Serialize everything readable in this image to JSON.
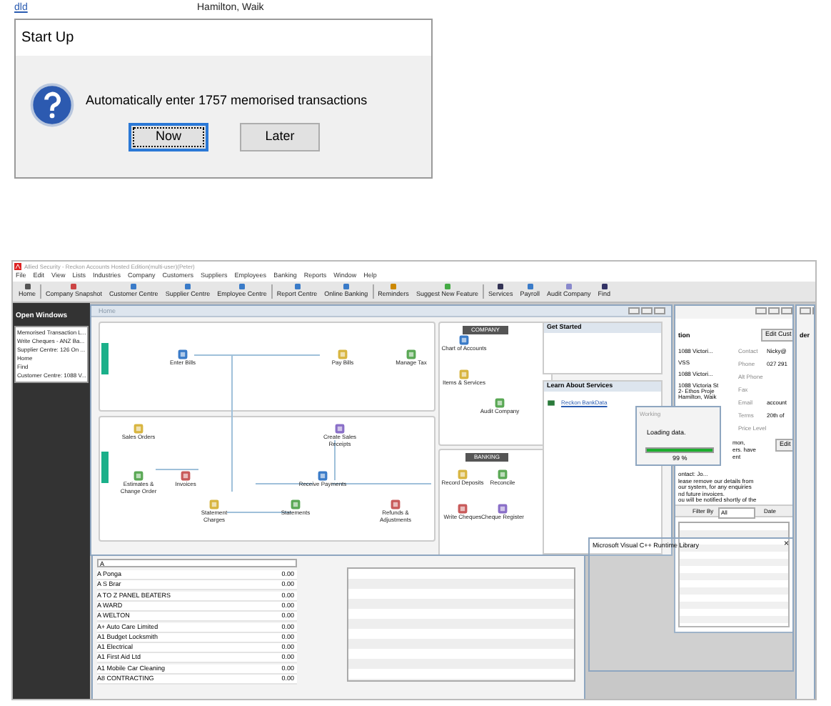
{
  "background_text": {
    "link": "dld",
    "address": "Hamilton, Waik"
  },
  "startup_dialog": {
    "title": "Start Up",
    "message": "Automatically enter 1757 memorised transactions",
    "buttons": [
      {
        "label": "Now",
        "selected": true
      },
      {
        "label": "Later",
        "selected": false
      }
    ]
  },
  "app": {
    "window_title": "Allied Security - Reckon Accounts Hosted Edition(multi-user)(Peter)",
    "menu": [
      "File",
      "Edit",
      "View",
      "Lists",
      "Industries",
      "Company",
      "Customers",
      "Suppliers",
      "Employees",
      "Banking",
      "Reports",
      "Window",
      "Help"
    ],
    "toolbar": [
      "Home",
      "Company Snapshot",
      "Customer Centre",
      "Supplier Centre",
      "Employee Centre",
      "Report Centre",
      "Online Banking",
      "Reminders",
      "Suggest New Feature",
      "Services",
      "Payroll",
      "Audit Company",
      "Find"
    ],
    "open_windows": {
      "title": "Open Windows",
      "items": [
        "Memorised Transaction L...",
        "Write Cheques - ANZ Ba...",
        "Supplier Centre: 126 On ...",
        "Home",
        "Find",
        "Customer Centre: 1088 V..."
      ]
    },
    "home": {
      "title": "Home",
      "suppliers": [
        "Enter Bills",
        "Pay Bills",
        "Manage Tax"
      ],
      "customers": [
        "Sales Orders",
        "Estimates & Change Order",
        "Invoices",
        "Create Sales Receipts",
        "Receive Payments",
        "Statement Charges",
        "Statements",
        "Refunds & Adjustments"
      ],
      "company": {
        "title": "COMPANY",
        "items": [
          "Chart of Accounts",
          "Items & Services",
          "Audit Company"
        ]
      },
      "banking": {
        "title": "BANKING",
        "items": [
          "Record Deposits",
          "Reconcile",
          "Write Cheques",
          "Cheque Register"
        ]
      },
      "get_started": {
        "title": "Get Started"
      },
      "services": {
        "title": "Learn About Services",
        "link": "Reckon BankData"
      }
    },
    "working": {
      "title": "Working",
      "message": "Loading data.",
      "level": 0.99,
      "reading": "99 %"
    },
    "customer": {
      "heading": "tion",
      "edit_button": "Edit Cust",
      "heading_2": "der",
      "address": [
        "1088 Victori...",
        "VSS",
        "1088 Victori...",
        "1088 Victoria St",
        "2- Ethos Proje",
        "Hamilton, Waik"
      ],
      "fields": [
        {
          "label": "Contact",
          "value": "Nicky@"
        },
        {
          "label": "Phone",
          "value": "027 291"
        },
        {
          "label": "Alt Phone"
        },
        {
          "label": "Fax"
        },
        {
          "label": "Email",
          "value": "account"
        },
        {
          "label": "Terms",
          "value": "20th of"
        },
        {
          "label": "Price Level"
        }
      ],
      "notes_edit": "Edit",
      "notes": [
        "mon,",
        "ers. have",
        "ent",
        "ontact: Jo...",
        "lease remove our details from",
        "our system, for any enquiries",
        "nd future invoices.",
        "ou will be notified shortly of the"
      ],
      "filter": {
        "label": "Filter By",
        "value": "All",
        "date_label": "Date"
      }
    },
    "runtime_window": {
      "title": "Microsoft Visual C++ Runtime Library",
      "close": "×"
    },
    "list": {
      "search": "A",
      "rows": [
        {
          "name": "A Ponga",
          "balance": "0.00"
        },
        {
          "name": "A S Brar",
          "balance": "0.00"
        },
        {
          "name": "A TO Z PANEL BEATERS",
          "balance": "0.00"
        },
        {
          "name": "A WARD",
          "balance": "0.00"
        },
        {
          "name": "A WELTON",
          "balance": "0.00"
        },
        {
          "name": "A+ Auto Care Limited",
          "balance": "0.00"
        },
        {
          "name": "A1 Budget Locksmith",
          "balance": "0.00"
        },
        {
          "name": "A1 Electrical",
          "balance": "0.00"
        },
        {
          "name": "A1 First Aid Ltd",
          "balance": "0.00"
        },
        {
          "name": "A1 Mobile Car Cleaning",
          "balance": "0.00"
        },
        {
          "name": "A8 CONTRACTING",
          "balance": "0.00"
        }
      ]
    }
  }
}
